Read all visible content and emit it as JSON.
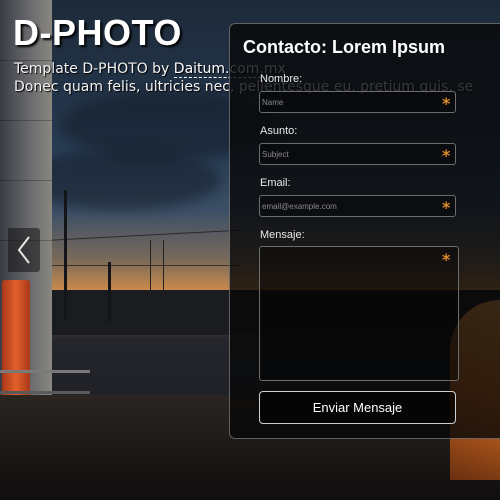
{
  "header": {
    "title": "D-PHOTO",
    "tagline_prefix": "Template D-PHOTO by ",
    "tagline_link": "Daitum.com.mx",
    "tagline_line2": "Donec quam felis, ultricies nec, pellentesque eu, pretium quis, se"
  },
  "slider": {
    "prev_icon": "chevron-left-icon"
  },
  "contact": {
    "title": "Contacto: Lorem Ipsum",
    "fields": {
      "name_label": "Nombre:",
      "name_placeholder": "Name",
      "subject_label": "Asunto:",
      "subject_placeholder": "Subject",
      "email_label": "Email:",
      "email_placeholder": "email@example.com",
      "message_label": "Mensaje:"
    },
    "required_marker": "*",
    "submit_label": "Enviar Mensaje"
  },
  "colors": {
    "accent_required": "#e08a2a",
    "panel_bg": "rgba(8,8,8,0.80)",
    "text": "#ffffff"
  }
}
